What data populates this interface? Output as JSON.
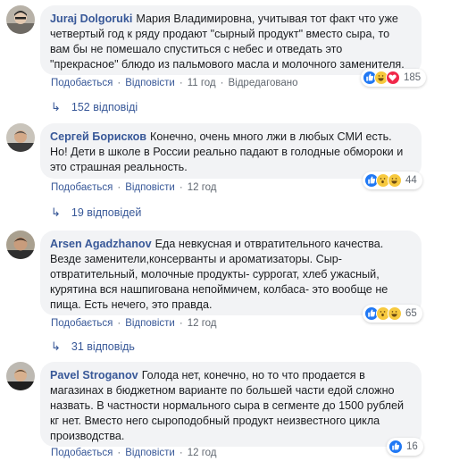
{
  "comments": [
    {
      "author": "Juraj Dolgoruki",
      "text": "Мария Владимировна, учитывая тот факт что уже четвертый год к ряду продают \"сырный продукт\" вместо сыра, то вам бы не помешало спуститься с небес и отведать это \"прекрасное\" блюдо из пальмового масла и молочного заменителя.",
      "like": "Подобається",
      "reply": "Відповісти",
      "time": "11 год",
      "edited": "Відредаговано",
      "reaction_count": "185",
      "replies": "152 відповіді"
    },
    {
      "author": "Сергей Борисков",
      "text": "Конечно, очень много лжи в любых СМИ есть. Но! Дети в школе в России реально падают в голодные обмороки и это страшная реальность.",
      "like": "Подобається",
      "reply": "Відповісти",
      "time": "12 год",
      "reaction_count": "44",
      "replies": "19 відповідей"
    },
    {
      "author": "Arsen Agadzhanov",
      "text": "Еда невкусная и отвратительного качества. Везде заменители,консерванты и ароматизаторы. Сыр-отвратительный, молочные продукты- суррогат, хлеб ужасный, курятина вся нашпигована непоймичем, колбаса- это вообще не пища. Есть нечего, это правда.",
      "like": "Подобається",
      "reply": "Відповісти",
      "time": "12 год",
      "reaction_count": "65",
      "replies": "31 відповідь"
    },
    {
      "author": "Pavel Stroganov",
      "text": "Голода нет, конечно, но то что продается в магазинах в бюджетном варианте по большей части едой сложно назвать. В частности нормального сыра в сегменте до 1500 рублей кг нет. Вместо него сыроподобный продукт неизвестного цикла производства.",
      "like": "Подобається",
      "reply": "Відповісти",
      "time": "12 год",
      "reaction_count": "16"
    }
  ],
  "colors": {
    "link": "#385898",
    "bubble": "#f2f3f5",
    "meta": "#606770",
    "like_blue": "#2078f4",
    "haha_yellow": "#f7c93e",
    "love_red": "#f0284a"
  },
  "icons": {
    "reply_arrow": "reply-arrow-icon",
    "like": "like-icon",
    "haha": "haha-icon",
    "wow": "wow-icon",
    "love": "love-icon"
  }
}
